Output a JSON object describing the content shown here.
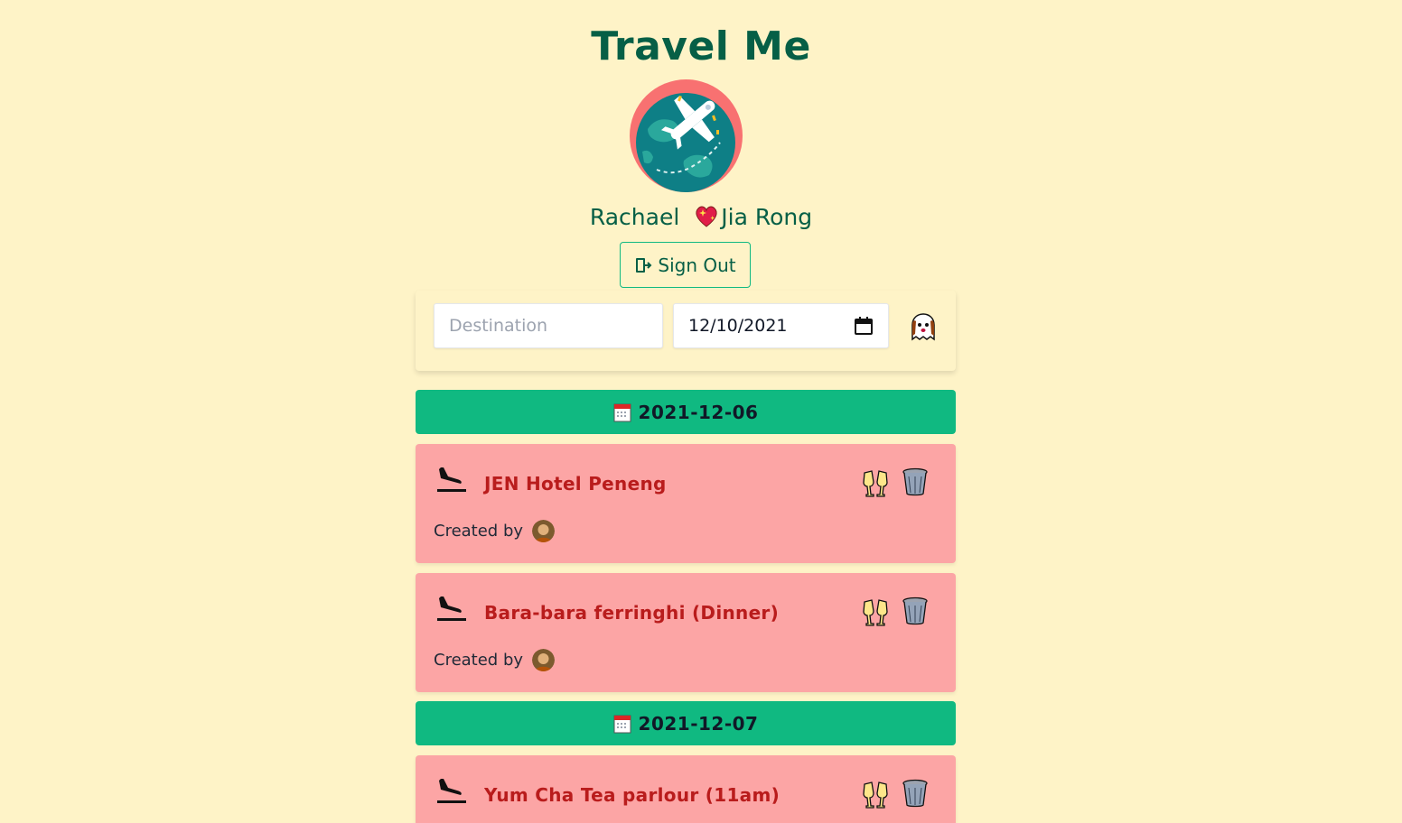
{
  "header": {
    "title": "Travel Me",
    "names_left": "Rachael",
    "names_right": "Jia Rong",
    "signout_label": "Sign Out"
  },
  "form": {
    "destination_placeholder": "Destination",
    "destination_value": "",
    "date_value": "12/10/2021"
  },
  "groups": [
    {
      "date": "2021-12-06",
      "trips": [
        {
          "title": "JEN Hotel Peneng",
          "created_by_label": "Created by"
        },
        {
          "title": "Bara-bara ferringhi (Dinner)",
          "created_by_label": "Created by"
        }
      ]
    },
    {
      "date": "2021-12-07",
      "trips": [
        {
          "title": "Yum Cha Tea parlour (11am)",
          "created_by_label": "Created by"
        }
      ]
    }
  ],
  "colors": {
    "background": "#fef3c7",
    "title": "#065f46",
    "date_bar": "#10b981",
    "card": "#fca5a5",
    "card_title": "#b91c1c"
  }
}
